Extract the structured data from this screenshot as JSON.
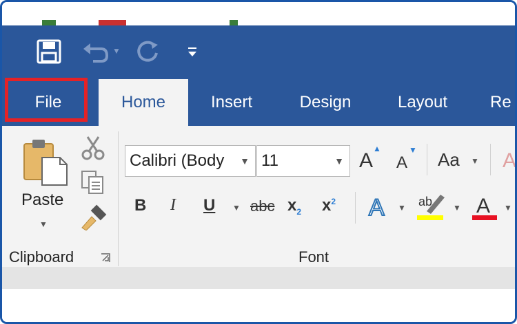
{
  "tabs": {
    "file": "File",
    "home": "Home",
    "insert": "Insert",
    "design": "Design",
    "layout": "Layout",
    "references_partial": "Re"
  },
  "clipboard": {
    "paste_label": "Paste",
    "group_label": "Clipboard"
  },
  "font": {
    "font_name": "Calibri (Body",
    "font_size": "11",
    "change_case_label": "Aa",
    "bold": "B",
    "italic": "I",
    "underline": "U",
    "strikethrough": "abc",
    "subscript_base": "x",
    "subscript_index": "2",
    "superscript_base": "x",
    "superscript_index": "2",
    "grow_font": "A",
    "shrink_font": "A",
    "text_effects": "A",
    "highlight_glyph": "ab",
    "font_color_glyph": "A",
    "group_label": "Font"
  },
  "colors": {
    "title_bar": "#2b579a",
    "ribbon": "#f3f3f3",
    "file_highlight": "#e52226",
    "highlight_yellow": "#ffff00",
    "font_color_red": "#e81123",
    "text_effects_blue": "#2e75b6"
  },
  "icons": {
    "save": "save-icon",
    "undo": "undo-icon",
    "redo": "redo-icon",
    "customize": "customize-quick-access-icon",
    "cut": "scissors-icon",
    "copy": "copy-icon",
    "format_painter": "format-painter-icon",
    "paste": "clipboard-paste-icon",
    "dialog_launcher": "dialog-launcher-icon"
  }
}
